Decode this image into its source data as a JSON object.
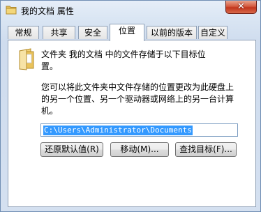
{
  "window": {
    "title": "我的文档 属性",
    "close_label": "✕"
  },
  "tabs": [
    {
      "label": "常规"
    },
    {
      "label": "共享"
    },
    {
      "label": "安全"
    },
    {
      "label": "位置",
      "active": true
    },
    {
      "label": "以前的版本"
    },
    {
      "label": "自定义"
    }
  ],
  "location": {
    "description_line1": "文件夹 我的文档 中的文件存储于以下目标位",
    "description_line2": "置。",
    "help_line1": "您可以将此文件夹中文件存储的位置更改为此硬盘上",
    "help_line2": "的另一个位置、另一个驱动器或网络上的另一台计算",
    "help_line3": "机。",
    "path_value": "C:\\Users\\Administrator\\Documents"
  },
  "buttons": {
    "restore_default": "还原默认值(R)",
    "move": "移动(M)...",
    "find_target": "查找目标(F)..."
  },
  "icons": {
    "title": "folder-icon",
    "panel": "folder-icon"
  }
}
